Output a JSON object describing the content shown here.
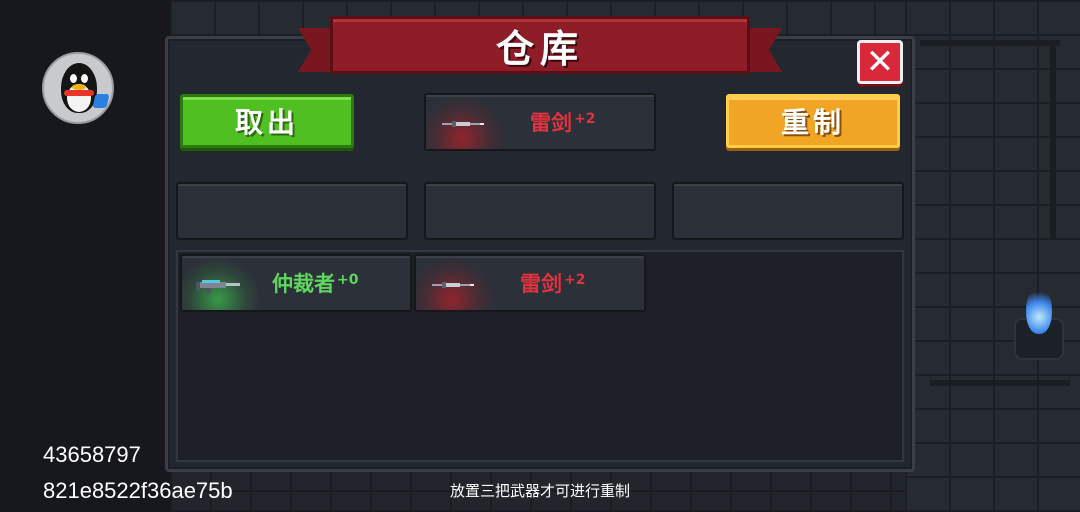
{
  "background": {
    "accent_flame": "#3c86ea"
  },
  "user": {
    "avatar_icon": "qq-penguin-icon",
    "id_number": "43658797",
    "id_hash": "821e8522f36ae75b"
  },
  "panel": {
    "title": "仓库",
    "close_label": "✕",
    "take_out_label": "取出",
    "remake_label": "重制",
    "preview_slot": {
      "name": "雷剑",
      "level": "+2",
      "color": "#e0323f",
      "icon": "sword-icon"
    },
    "remake_slots": [
      {
        "empty": true
      },
      {
        "empty": true
      },
      {
        "empty": true
      }
    ],
    "inventory": [
      {
        "name": "仲裁者",
        "level": "+0",
        "color": "#5fd65f",
        "icon": "rifle-icon"
      },
      {
        "name": "雷剑",
        "level": "+2",
        "color": "#e0323f",
        "icon": "sword-icon"
      }
    ]
  },
  "hint": "放置三把武器才可进行重制"
}
